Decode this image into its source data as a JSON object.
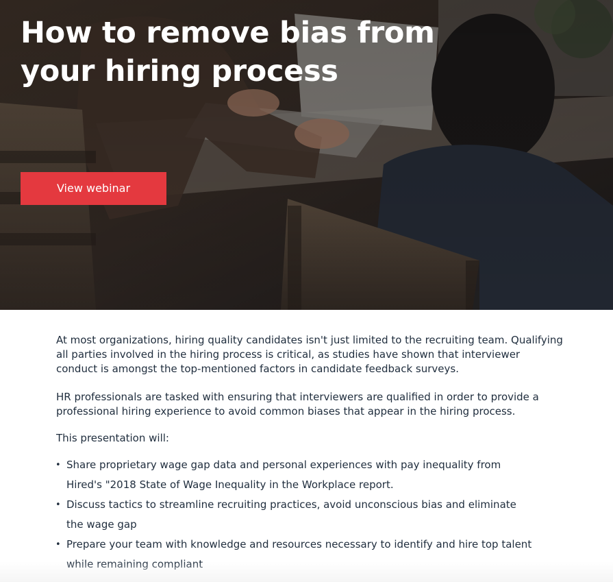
{
  "hero": {
    "title": "How to remove bias from your hiring process",
    "cta_label": "View webinar"
  },
  "content": {
    "paragraph1": "At most organizations, hiring quality candidates isn't just limited to the recruiting team. Qualifying all parties involved in the hiring process is critical, as studies have shown that interviewer conduct is amongst the top-mentioned factors in candidate feedback surveys.",
    "paragraph2": "HR professionals are tasked with ensuring that interviewers are qualified in order to provide a professional hiring experience to avoid common biases that appear in the hiring process.",
    "lead": "This presentation will:",
    "bullet_glyph": "•",
    "bullets": [
      "Share proprietary wage gap data and personal experiences with pay inequality from Hired's \"2018 State of Wage Inequality in the Workplace report.",
      "Discuss tactics to streamline recruiting practices, avoid unconscious bias and eliminate the wage gap",
      "Prepare your team with knowledge and resources necessary to identify and hire top talent while remaining compliant"
    ]
  },
  "colors": {
    "cta_background": "#e4393f",
    "body_text": "#1f2d3d",
    "hero_overlay": "#2a2420"
  }
}
